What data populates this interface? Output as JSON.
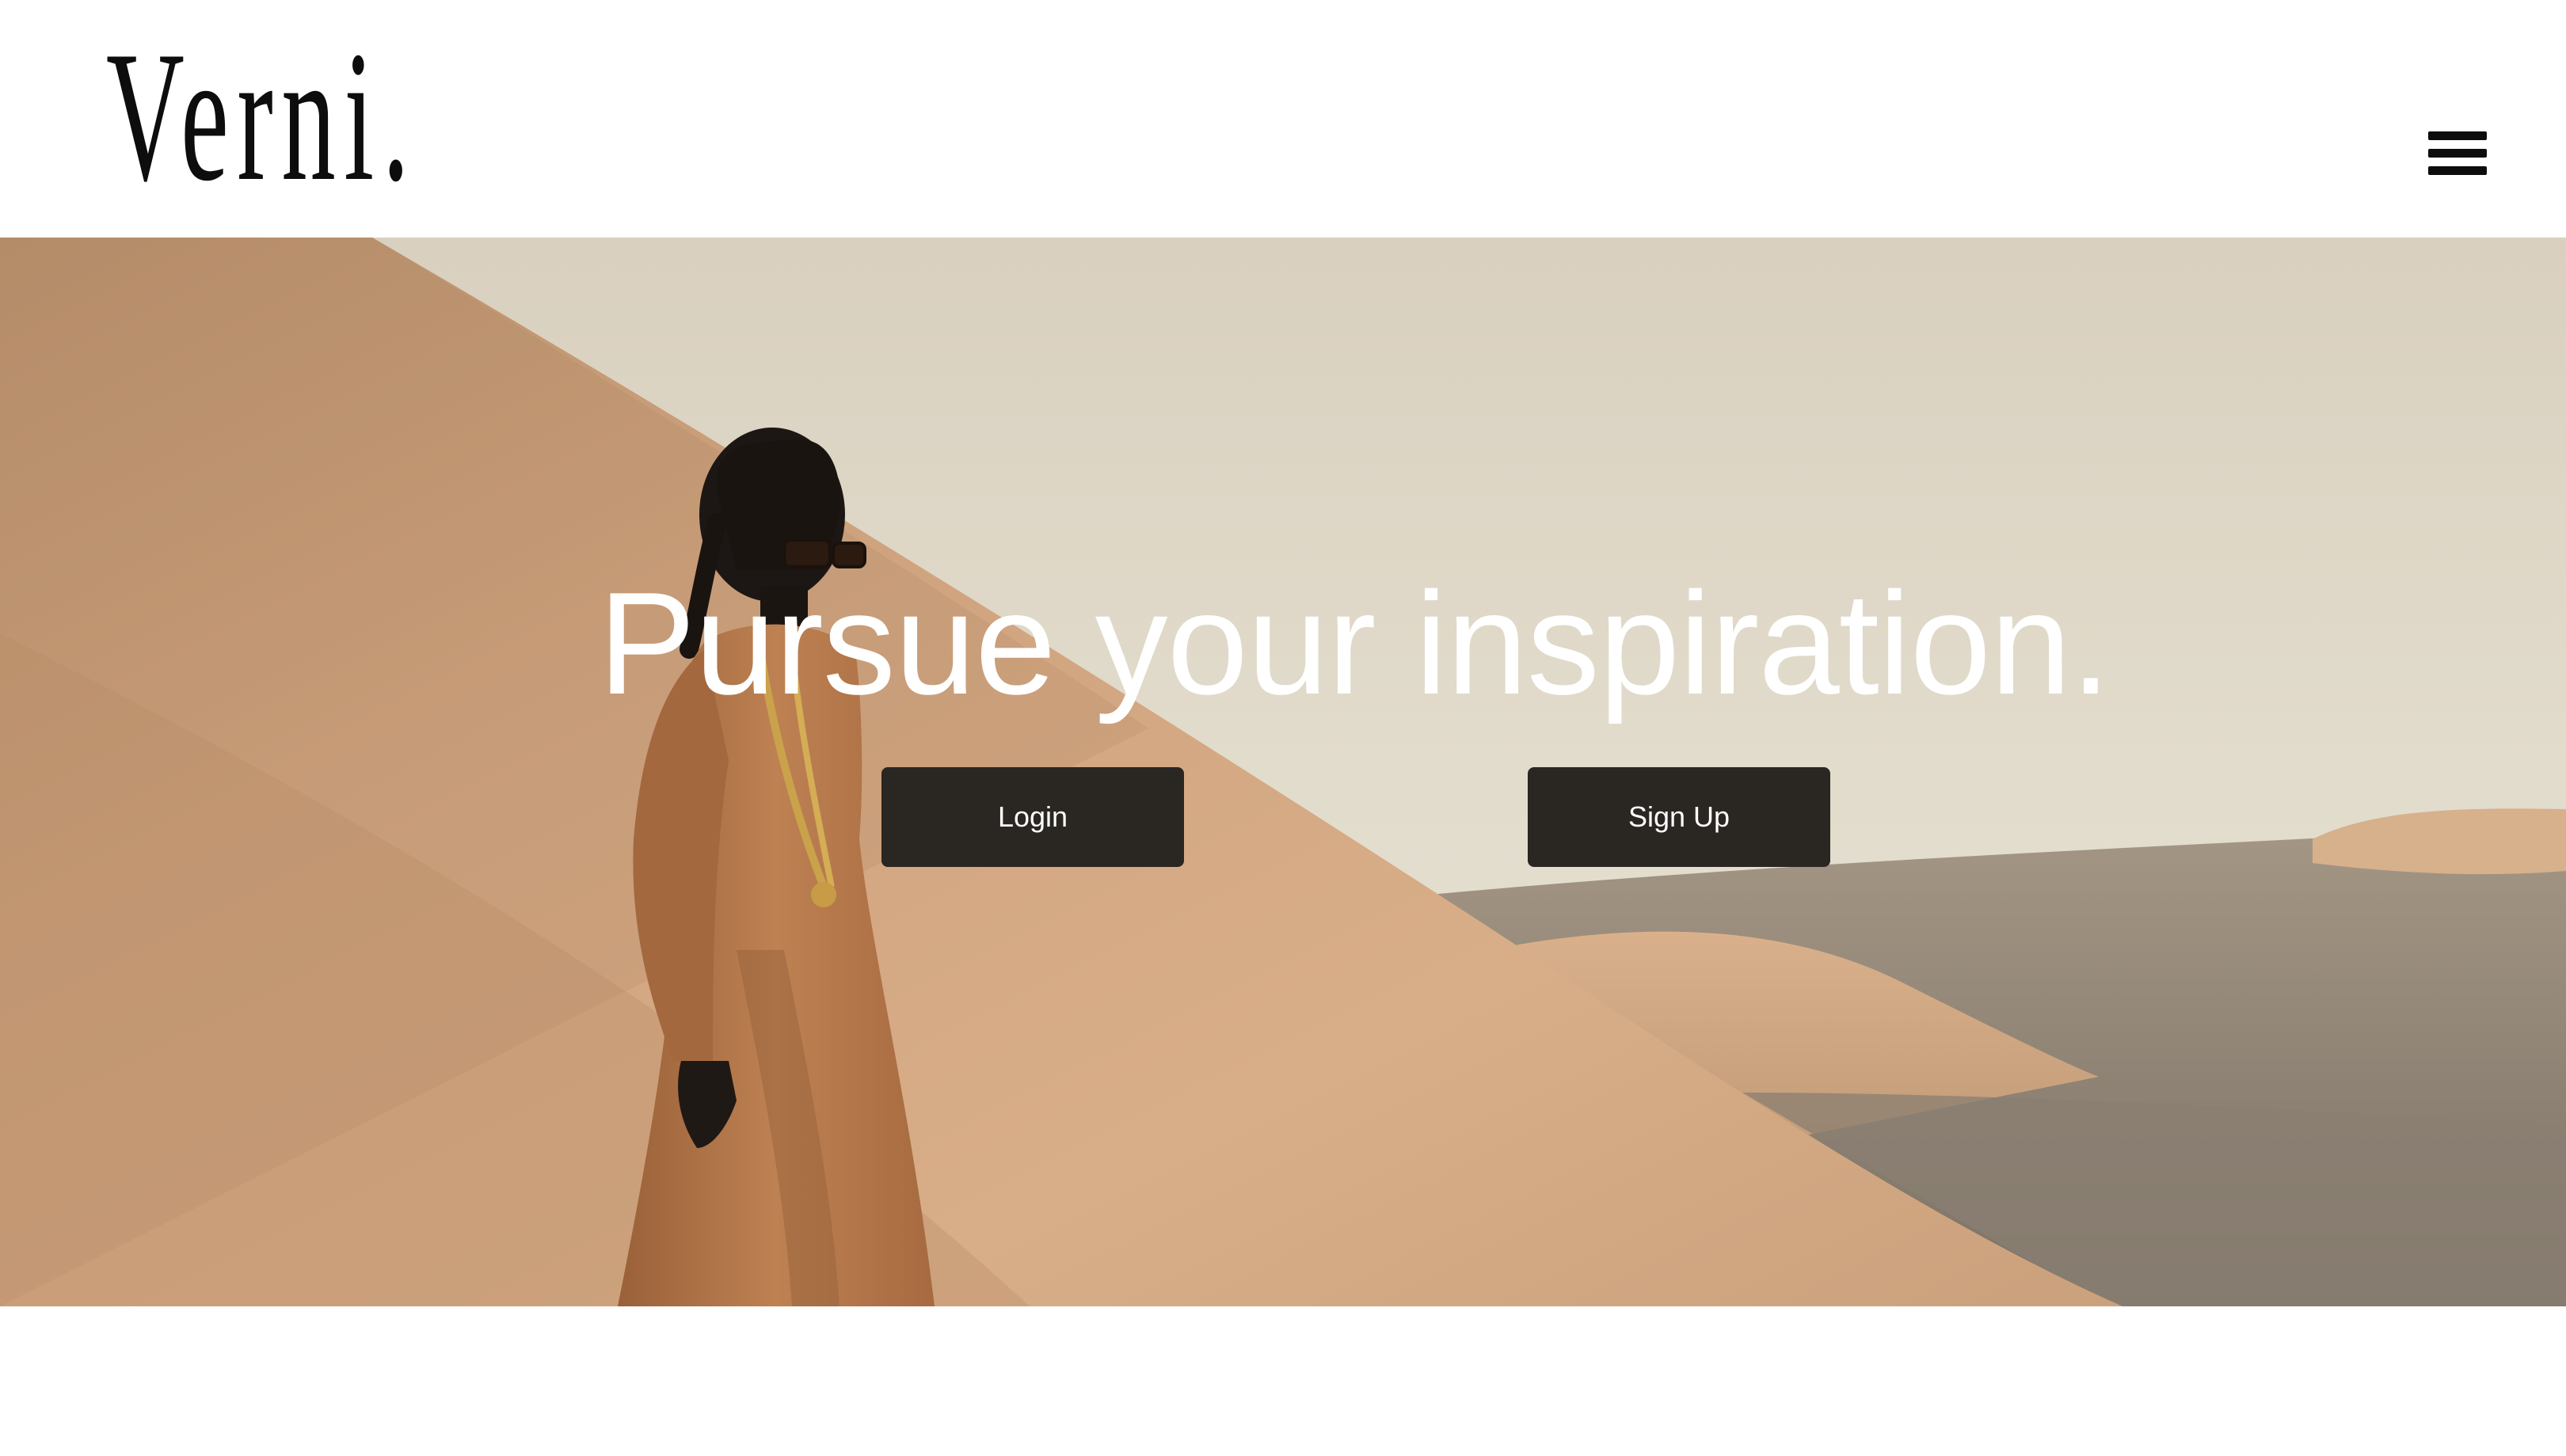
{
  "header": {
    "logo_text": "Verni.",
    "menu_icon": "hamburger-menu-icon"
  },
  "hero": {
    "heading": "Pursue your inspiration.",
    "login_label": "Login",
    "signup_label": "Sign Up",
    "button_color": "#2a2622",
    "heading_color": "#ffffff"
  }
}
